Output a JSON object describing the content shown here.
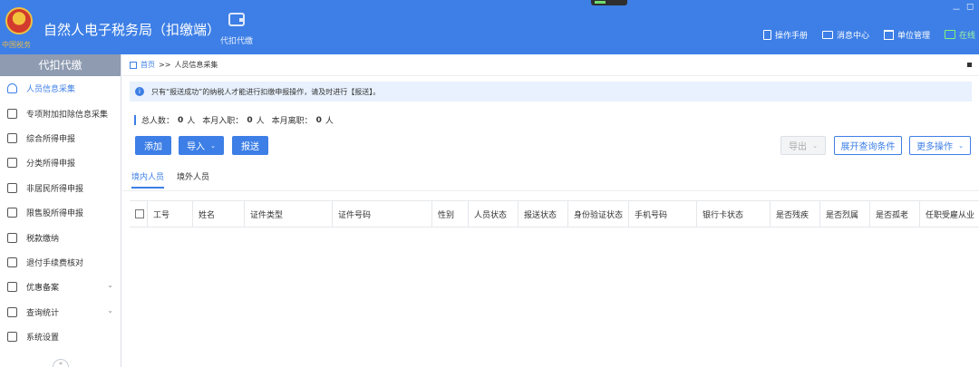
{
  "app": {
    "title": "自然人电子税务局（扣缴端）",
    "emblem_text": "中国税务",
    "top_nav_label": "代扣代缴",
    "window_minimize": "－",
    "window_restore": "◻",
    "top_actions": [
      "操作手册",
      "消息中心",
      "单位管理",
      "在线"
    ],
    "colors": {
      "primary": "#3d7fe6",
      "sidebar_header": "#8e9bb1",
      "online": "#9ef59e"
    }
  },
  "sidebar": {
    "header": "代扣代缴",
    "items": [
      {
        "label": "人员信息采集",
        "icon": "person-icon",
        "active": true
      },
      {
        "label": "专项附加扣除信息采集",
        "icon": "list-icon"
      },
      {
        "label": "综合所得申报",
        "icon": "layers-icon"
      },
      {
        "label": "分类所得申报",
        "icon": "pie-icon"
      },
      {
        "label": "非居民所得申报",
        "icon": "person-outline-icon"
      },
      {
        "label": "限售股所得申报",
        "icon": "bar-chart-icon"
      },
      {
        "label": "税款缴纳",
        "icon": "folder-icon"
      },
      {
        "label": "退付手续费核对",
        "icon": "document-icon"
      },
      {
        "label": "优惠备案",
        "icon": "file-icon",
        "expandable": true
      },
      {
        "label": "查询统计",
        "icon": "search-list-icon",
        "expandable": true
      },
      {
        "label": "系统设置",
        "icon": "gear-icon"
      }
    ],
    "collapse_label": "«"
  },
  "breadcrumb": {
    "home": "首页",
    "separator": ">>",
    "current": "人员信息采集"
  },
  "notice": {
    "icon": "i",
    "text": "只有“报送成功”的纳税人才能进行扣缴申报操作，请及时进行【报送】。"
  },
  "stats": {
    "total_label": "总人数：",
    "total_value": "0",
    "unit": "人",
    "hired_label": "本月入职：",
    "hired_value": "0",
    "left_label": "本月离职：",
    "left_value": "0"
  },
  "toolbar": {
    "add": "添加",
    "import": "导入",
    "submit": "报送",
    "export": "导出",
    "expand_query": "展开查询条件",
    "more_actions": "更多操作",
    "caret": "⌄"
  },
  "tabs": [
    "境内人员",
    "境外人员"
  ],
  "table": {
    "columns": [
      "工号",
      "姓名",
      "证件类型",
      "证件号码",
      "性别",
      "人员状态",
      "报送状态",
      "身份验证状态",
      "手机号码",
      "银行卡状态",
      "是否残疾",
      "是否烈属",
      "是否孤老",
      "任职受雇从业"
    ]
  }
}
